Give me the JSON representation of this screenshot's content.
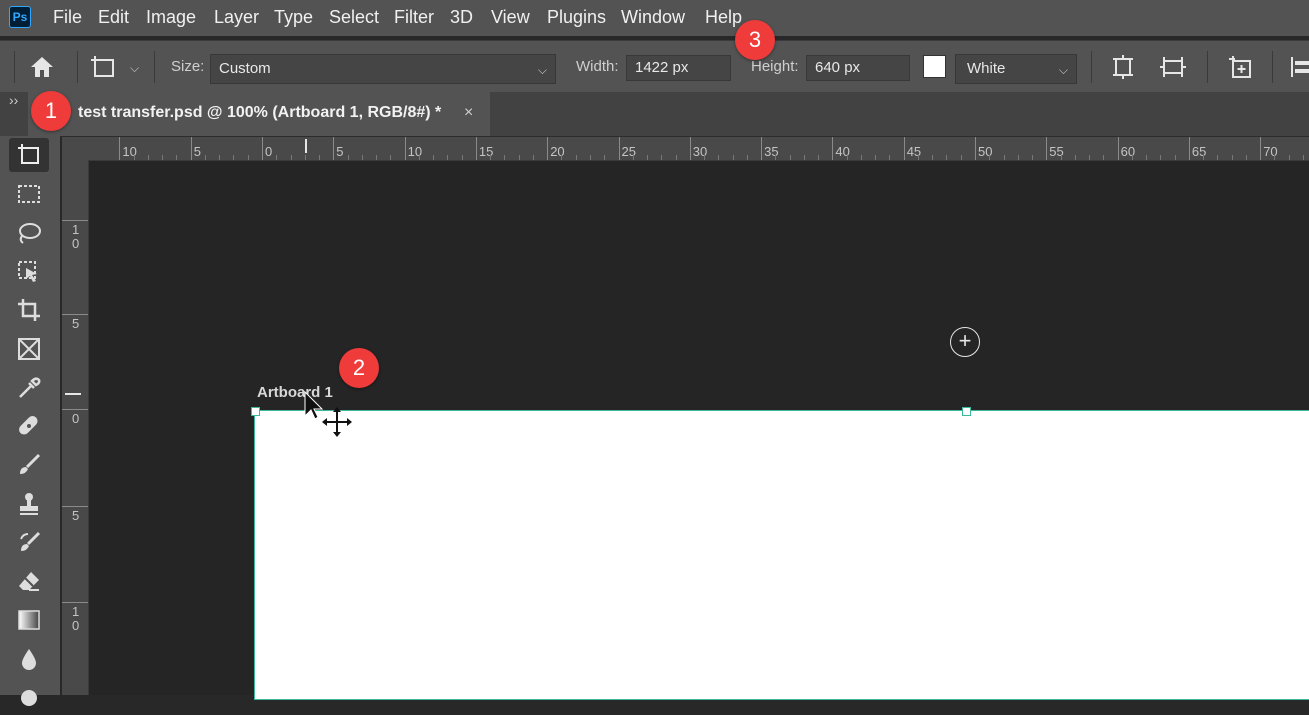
{
  "app": {
    "logo_text": "Ps"
  },
  "menu": [
    "File",
    "Edit",
    "Image",
    "Layer",
    "Type",
    "Select",
    "Filter",
    "3D",
    "View",
    "Plugins",
    "Window",
    "Help"
  ],
  "options": {
    "size_label": "Size:",
    "size_value": "Custom",
    "width_label": "Width:",
    "width_value": "1422 px",
    "height_label": "Height:",
    "height_value": "640 px",
    "color_value": "White",
    "color_swatch": "#ffffff"
  },
  "tab": {
    "collapse": "››",
    "title": "test transfer.psd @ 100% (Artboard 1, RGB/8#) *",
    "close": "×"
  },
  "ruler_top_labels": [
    "10",
    "5",
    "0",
    "5",
    "10",
    "15",
    "20",
    "25",
    "30",
    "35",
    "40",
    "45",
    "50",
    "55",
    "60",
    "65",
    "70"
  ],
  "ruler_left_labels": [
    "1\n0",
    "5",
    "0",
    "5",
    "1\n0"
  ],
  "canvas": {
    "artboard_label": "Artboard 1",
    "add_button": "+"
  },
  "badges": [
    "1",
    "2",
    "3"
  ],
  "icons": {
    "tools": [
      "artboard-tool-icon",
      "rectangular-marquee-icon",
      "lasso-icon",
      "object-selection-icon",
      "crop-icon",
      "frame-icon",
      "eyedropper-icon",
      "healing-brush-icon",
      "brush-icon",
      "clone-stamp-icon",
      "history-brush-icon",
      "eraser-icon",
      "gradient-icon",
      "blur-drop-icon",
      "dodge-icon"
    ]
  },
  "colors": {
    "accent": "#31a8ff",
    "badge": "#f03b3b",
    "artboard_outline": "#3cb89a"
  }
}
